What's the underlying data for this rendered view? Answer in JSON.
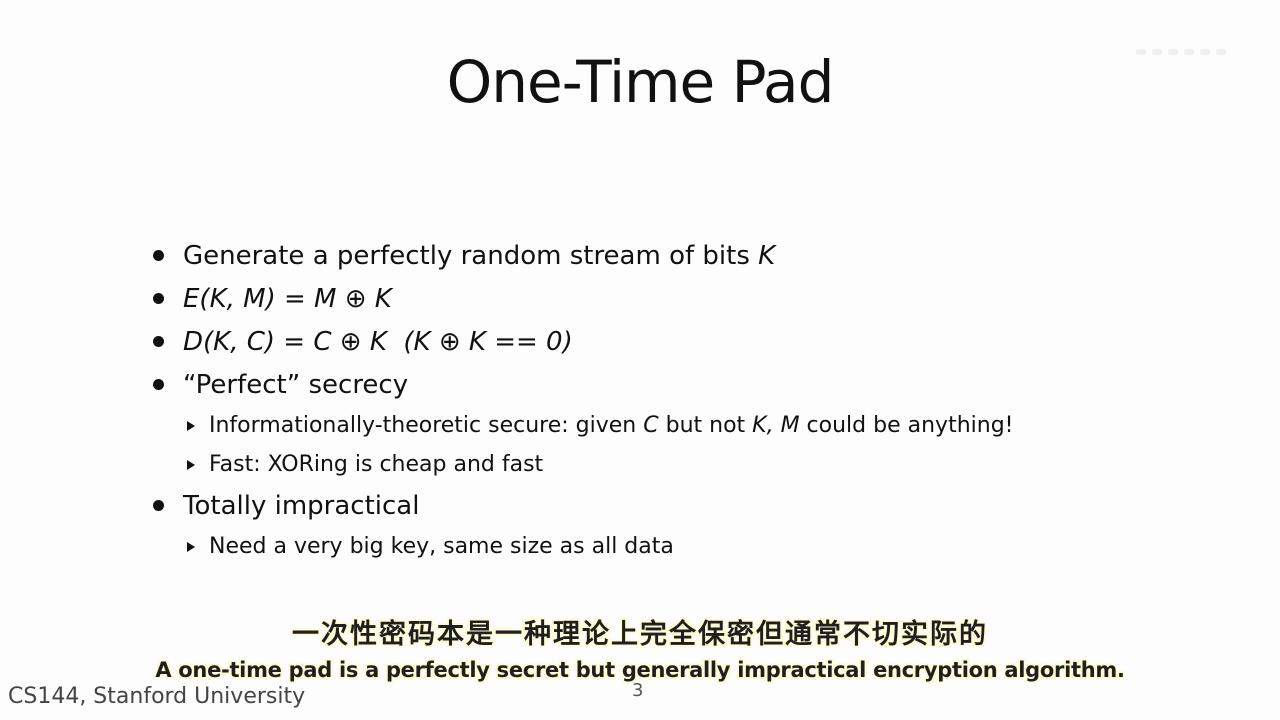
{
  "slide": {
    "title": "One-Time Pad",
    "bullets": [
      {
        "text": "Generate a perfectly random stream of bits ",
        "italic_tail": "K"
      },
      {
        "italic_text": "E(K, M) = M ⊕ K"
      },
      {
        "italic_text": "D(K, C) = C ⊕ K  (K ⊕ K == 0)"
      },
      {
        "text": "“Perfect” secrecy"
      }
    ],
    "sub_bullets_perfect": [
      {
        "text_a": "Informationally-theoretic secure: given ",
        "italic_a": "C",
        "text_b": " but not ",
        "italic_b": "K, M",
        "text_c": " could be anything!"
      },
      {
        "text": "Fast: XORing is cheap and fast"
      }
    ],
    "bullet_impractical": "Totally impractical",
    "sub_bullets_impractical": [
      {
        "text": "Need a very big key, same size as all data"
      }
    ],
    "footer_course": "CS144, Stanford University",
    "page_number": "3"
  },
  "subtitles": {
    "chinese": "一次性密码本是一种理论上完全保密但通常不切实际的",
    "english": "A one-time pad is a perfectly secret but generally impractical encryption algorithm."
  },
  "colors": {
    "background": "#fdfdfd",
    "text": "#111111",
    "subtitle_outline": "#fffbd6"
  }
}
